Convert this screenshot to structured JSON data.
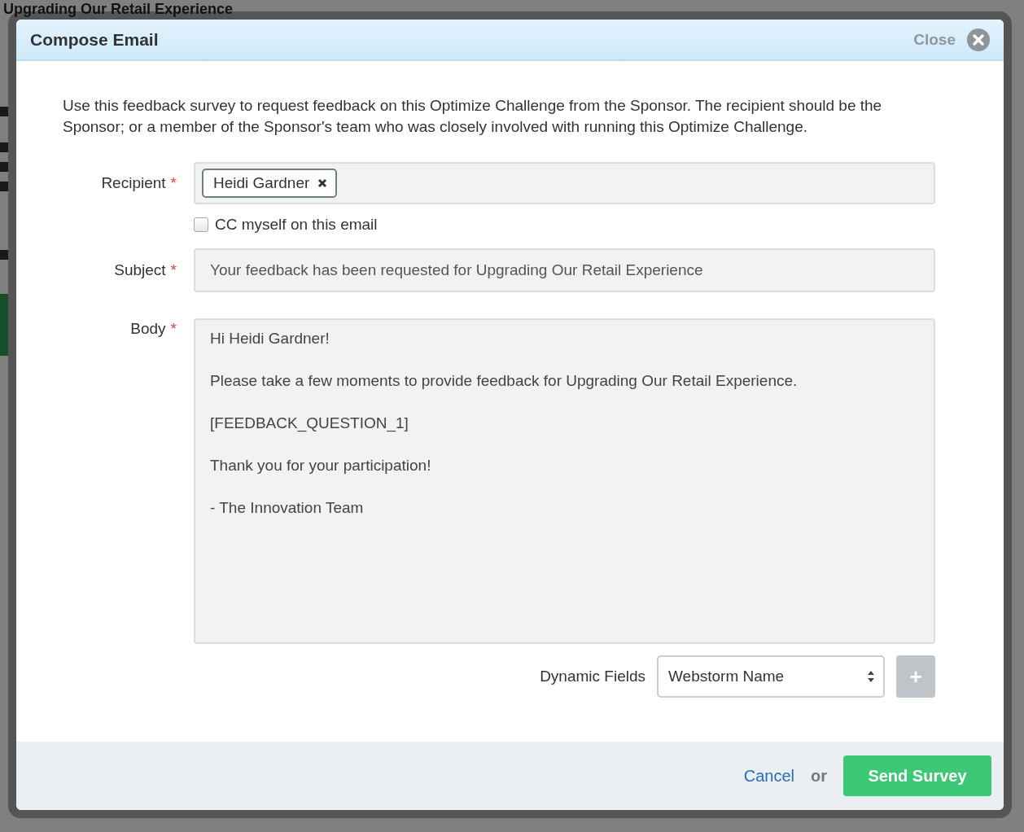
{
  "background": {
    "title": "Upgrading Our Retail Experience"
  },
  "dialog": {
    "title": "Compose Email",
    "close_label": "Close",
    "required_mark": "*",
    "intro": "Use this feedback survey to request feedback on this Optimize Challenge from the Sponsor. The recipient should be the Sponsor; or a member of the Sponsor's team who was closely involved with running this Optimize Challenge.",
    "recipient": {
      "label": "Recipient",
      "required": true,
      "tags": [
        "Heidi Gardner"
      ]
    },
    "cc_myself": {
      "label": "CC myself on this email",
      "checked": false
    },
    "subject": {
      "label": "Subject",
      "required": true,
      "value": "Your feedback has been requested for Upgrading Our Retail Experience"
    },
    "body": {
      "label": "Body",
      "required": true,
      "lines": [
        "Hi Heidi Gardner!",
        "Please take a few moments to provide feedback for Upgrading Our Retail Experience.",
        "[FEEDBACK_QUESTION_1]",
        "Thank you for your participation!",
        "- The Innovation Team"
      ]
    },
    "dynamic_fields": {
      "label": "Dynamic Fields",
      "value": "Webstorm Name",
      "add_label": "+",
      "add_disabled": true
    },
    "footer": {
      "cancel": "Cancel",
      "or": "or",
      "submit": "Send Survey"
    }
  }
}
